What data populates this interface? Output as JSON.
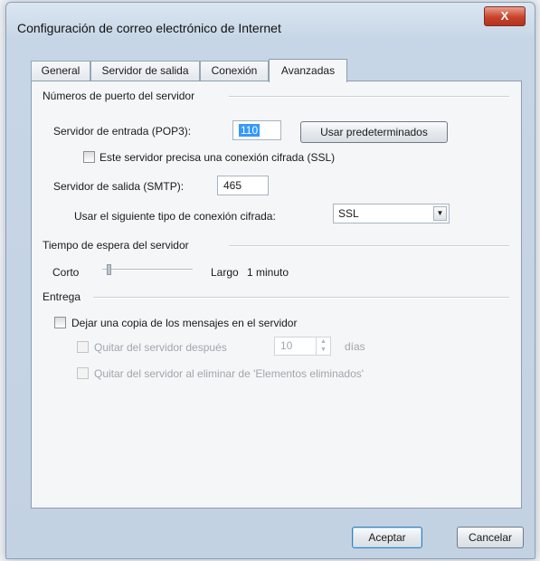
{
  "dialog": {
    "title": "Configuración de correo electrónico de Internet",
    "close_label": "X"
  },
  "tabs": [
    {
      "label": "General"
    },
    {
      "label": "Servidor de salida"
    },
    {
      "label": "Conexión"
    },
    {
      "label": "Avanzadas"
    }
  ],
  "ports": {
    "group_title": "Números de puerto del servidor",
    "incoming_label": "Servidor de entrada (POP3):",
    "incoming_value": "110",
    "defaults_button": "Usar predeterminados",
    "ssl_checkbox_label": "Este servidor precisa una conexión cifrada (SSL)",
    "outgoing_label": "Servidor de salida (SMTP):",
    "outgoing_value": "465",
    "encryption_label": "Usar el siguiente tipo de conexión cifrada:",
    "encryption_value": "SSL"
  },
  "timeout": {
    "group_title": "Tiempo de espera del servidor",
    "short_label": "Corto",
    "long_label": "Largo",
    "value_label": "1 minuto",
    "slider_level": 0.05
  },
  "delivery": {
    "group_title": "Entrega",
    "leave_copy_label": "Dejar una copia de los mensajes en el servidor",
    "remove_after_label": "Quitar del servidor después",
    "days_value": "10",
    "days_label": "días",
    "remove_deleted_label": "Quitar del servidor al eliminar de 'Elementos eliminados'"
  },
  "footer": {
    "ok_button": "Aceptar",
    "cancel_button": "Cancelar"
  },
  "colors": {
    "close_button": "#c8432c",
    "selection": "#3399ff"
  }
}
